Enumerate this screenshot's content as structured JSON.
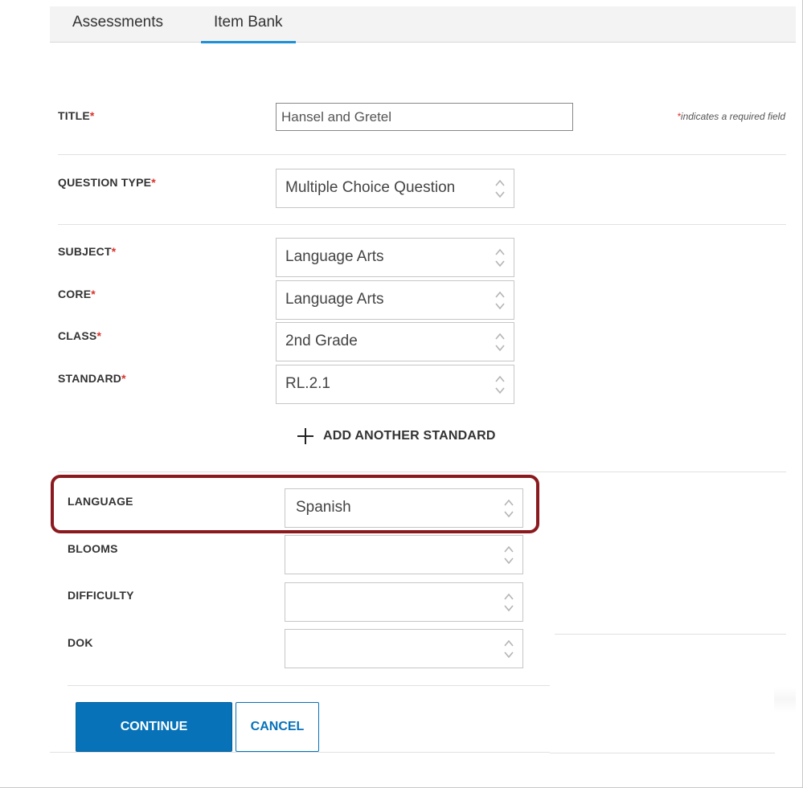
{
  "tabs": [
    {
      "label": "Assessments",
      "active": false
    },
    {
      "label": "Item Bank",
      "active": true
    }
  ],
  "required_marker": "*",
  "required_note": {
    "marker": "*",
    "text": "indicates a required field"
  },
  "fields": {
    "title": {
      "label": "TITLE",
      "value": "Hansel and Gretel"
    },
    "question_type": {
      "label": "QUESTION TYPE",
      "value": "Multiple Choice Question"
    },
    "subject": {
      "label": "SUBJECT",
      "value": "Language Arts"
    },
    "core": {
      "label": "CORE",
      "value": "Language Arts"
    },
    "class": {
      "label": "CLASS",
      "value": "2nd Grade"
    },
    "standard": {
      "label": "STANDARD",
      "value": "RL.2.1"
    },
    "language": {
      "label": "LANGUAGE",
      "value": "Spanish"
    },
    "blooms": {
      "label": "BLOOMS",
      "value": ""
    },
    "difficulty": {
      "label": "DIFFICULTY",
      "value": ""
    },
    "dok": {
      "label": "DOK",
      "value": ""
    }
  },
  "add_standard_label": "ADD ANOTHER STANDARD",
  "buttons": {
    "continue": "CONTINUE",
    "cancel": "CANCEL"
  },
  "colors": {
    "accent": "#0772b8",
    "tab_underline": "#1f8fd6",
    "required": "#d9322b",
    "highlight": "#8b1a1f"
  },
  "icons": {
    "select_arrows": "chevron-up-down-icon",
    "add": "plus-icon"
  }
}
